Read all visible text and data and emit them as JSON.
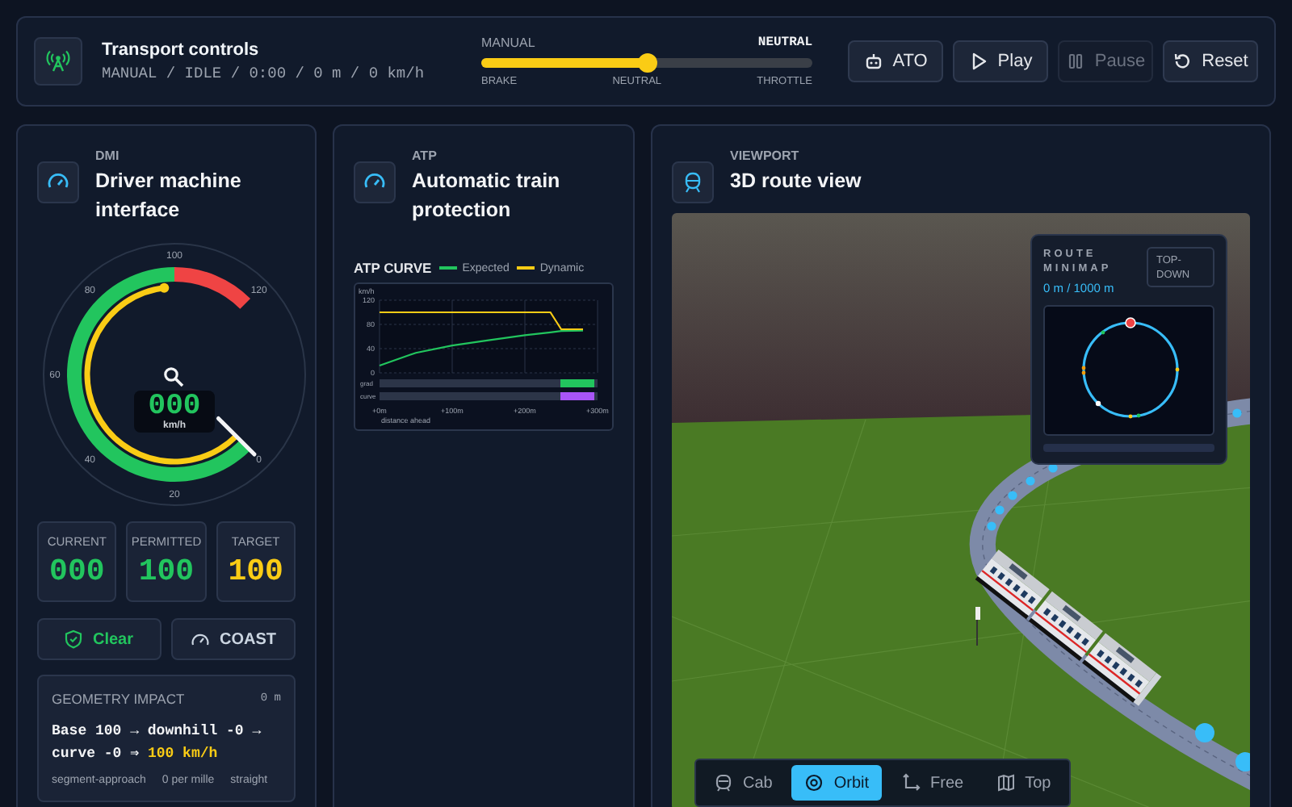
{
  "transport": {
    "title": "Transport controls",
    "status": "MANUAL / IDLE / 0:00 / 0 m / 0 km/h",
    "mode": "MANUAL",
    "lever_state": "NEUTRAL",
    "lever": {
      "level": 0.5
    },
    "lever_labels": [
      "BRAKE",
      "NEUTRAL",
      "THROTTLE"
    ],
    "buttons": [
      {
        "kind": "ato",
        "label": "ATO",
        "disabled": false
      },
      {
        "kind": "play",
        "label": "Play",
        "disabled": false
      },
      {
        "kind": "pause",
        "label": "Pause",
        "disabled": true
      },
      {
        "kind": "reset",
        "label": "Reset",
        "disabled": false
      }
    ]
  },
  "dmi": {
    "eyebrow": "DMI",
    "title": "Driver machine interface",
    "gauge": {
      "ticks": [
        "0",
        "20",
        "40",
        "60",
        "80",
        "100",
        "120"
      ],
      "readout": "000",
      "unit": "km/h"
    },
    "tiles": [
      {
        "kind": "current",
        "label": "CURRENT",
        "value": "000",
        "color": "#22c55e"
      },
      {
        "kind": "permitted",
        "label": "PERMITTED",
        "value": "100",
        "color": "#22c55e"
      },
      {
        "kind": "target",
        "label": "TARGET",
        "value": "100",
        "color": "#facc15"
      }
    ],
    "status": {
      "label": "Clear"
    },
    "mode": {
      "label": "COAST"
    },
    "impact": {
      "title": "GEOMETRY IMPACT",
      "distance": "0 m",
      "formula": "Base 100 → downhill -0 → curve -0 ⇒",
      "result": "100 km/h",
      "facts": [
        "segment-approach",
        "0 per mille",
        "straight"
      ]
    }
  },
  "atp": {
    "eyebrow": "ATP",
    "title": "Automatic train protection",
    "curve": {
      "title": "ATP CURVE",
      "chart_data": {
        "type": "line",
        "xlabel": "distance ahead",
        "ylabel": "km/h",
        "x": [
          0,
          50,
          100,
          150,
          200,
          235,
          250,
          280
        ],
        "series": [
          {
            "name": "Expected",
            "color": "#22c55e",
            "values": [
              12,
              33,
              45,
              54,
              62,
              67,
              69,
              70
            ]
          },
          {
            "name": "Dynamic",
            "color": "#facc15",
            "values": [
              100,
              100,
              100,
              100,
              100,
              100,
              72,
              72
            ]
          }
        ],
        "grid": true,
        "xlim": [
          0,
          300
        ],
        "ylim": [
          0,
          120
        ],
        "yticks": [
          0,
          40,
          80,
          120
        ],
        "xticks": [
          {
            "value": 0,
            "label": "+0m"
          },
          {
            "value": 100,
            "label": "+100m"
          },
          {
            "value": 200,
            "label": "+200m"
          },
          {
            "value": 300,
            "label": "+300m"
          }
        ]
      },
      "profile": [
        {
          "label": "grad",
          "color": "#22c55e"
        },
        {
          "label": "curve",
          "color": "#a855f7"
        }
      ]
    }
  },
  "viewport": {
    "eyebrow": "VIEWPORT",
    "title": "3D route view",
    "minimap": {
      "title": "ROUTE MINIMAP",
      "position": "0 m / 1000 m",
      "view_button": "TOP-DOWN",
      "progress": {
        "level": 0
      }
    },
    "cameras": [
      {
        "kind": "cab",
        "label": "Cab",
        "selected": false
      },
      {
        "kind": "orbit",
        "label": "Orbit",
        "selected": true
      },
      {
        "kind": "free",
        "label": "Free",
        "selected": false
      },
      {
        "kind": "top",
        "label": "Top",
        "selected": false
      }
    ]
  }
}
